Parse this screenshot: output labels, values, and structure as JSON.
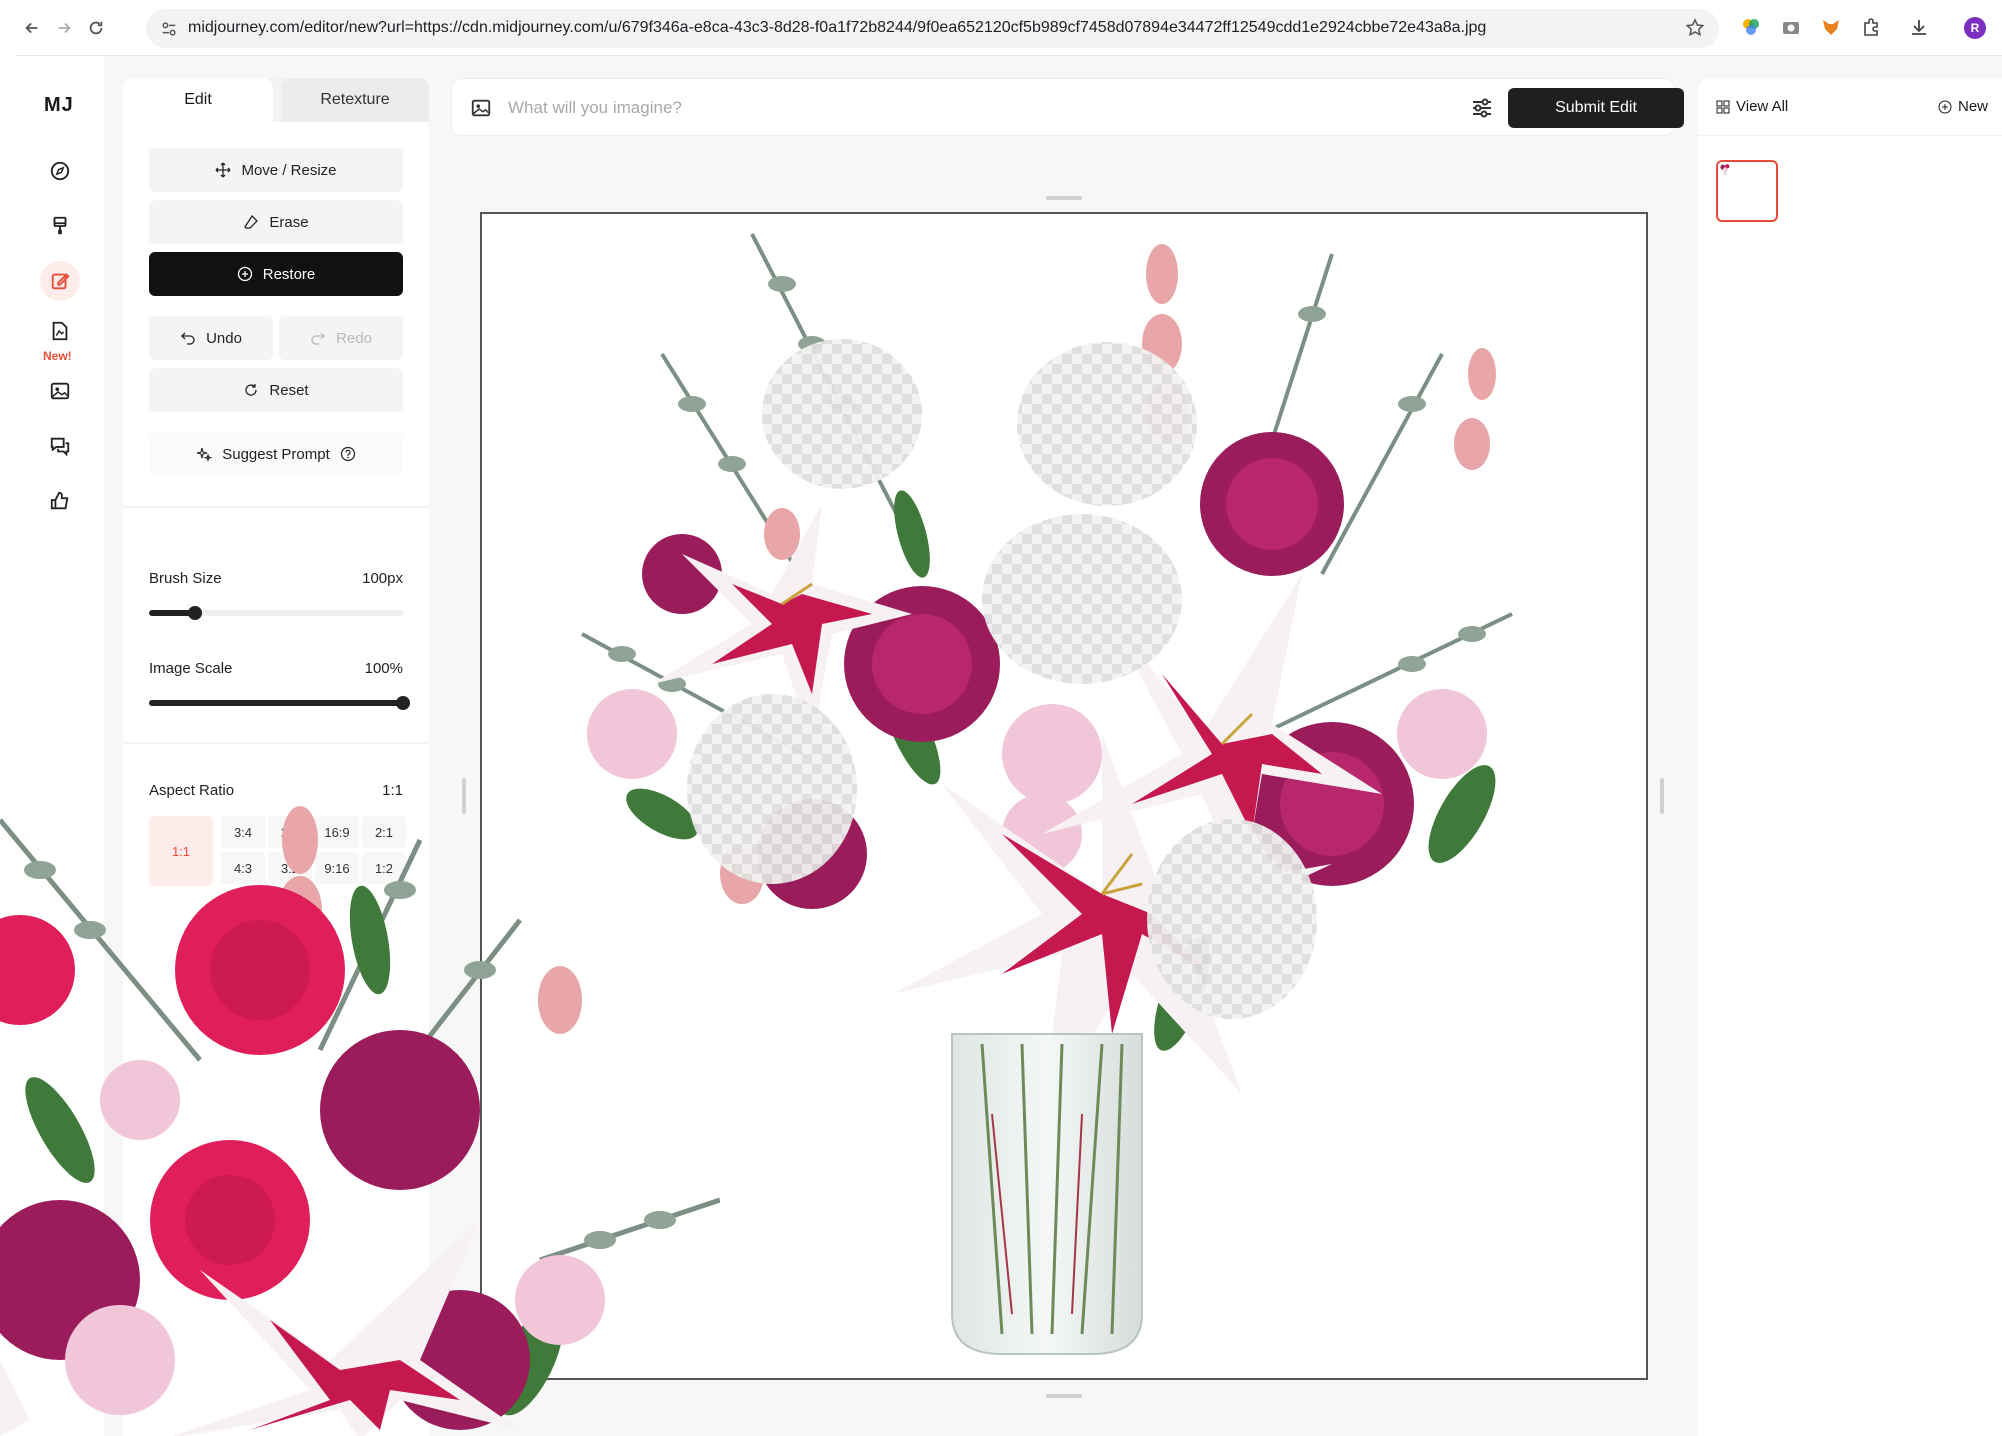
{
  "browser": {
    "url": "midjourney.com/editor/new?url=https://cdn.midjourney.com/u/679f346a-e8ca-43c3-8d28-f0a1f72b8244/9f0ea652120cf5b989cf7458d07894e34472ff12549cdd1e2924cbbe72e43a8a.jpg",
    "profile_initial": "R"
  },
  "rail": {
    "logo": "MJ",
    "new_badge": "New!"
  },
  "panel": {
    "tabs": [
      {
        "label": "Edit",
        "active": true
      },
      {
        "label": "Retexture",
        "active": false
      }
    ],
    "tools": {
      "move_resize": "Move / Resize",
      "erase": "Erase",
      "restore": "Restore",
      "undo": "Undo",
      "redo": "Redo",
      "reset": "Reset",
      "suggest_prompt": "Suggest Prompt"
    },
    "brush_size": {
      "label": "Brush Size",
      "value": "100px",
      "level": 0.18
    },
    "image_scale": {
      "label": "Image Scale",
      "value": "100%",
      "level": 1.0
    },
    "aspect_ratio": {
      "label": "Aspect Ratio",
      "value": "1:1",
      "selected": "1:1",
      "options_top": [
        "3:4",
        "2:3",
        "16:9",
        "2:1"
      ],
      "options_bottom": [
        "4:3",
        "3:2",
        "9:16",
        "1:2"
      ]
    }
  },
  "prompt": {
    "placeholder": "What will you imagine?",
    "submit_label": "Submit Edit"
  },
  "gallery": {
    "view_all": "View All",
    "new": "New"
  },
  "colors": {
    "accent": "#e94d3a",
    "dark_button": "#111111"
  }
}
